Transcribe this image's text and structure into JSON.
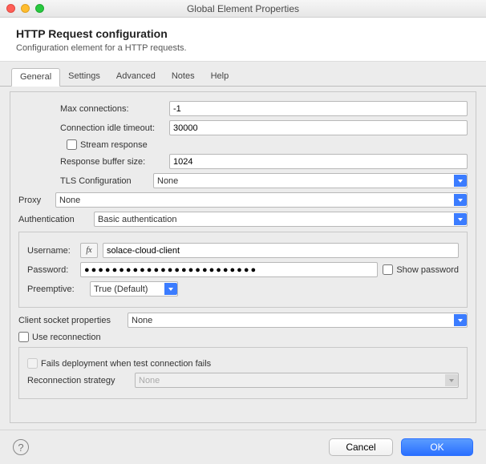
{
  "window": {
    "title": "Global Element Properties"
  },
  "header": {
    "title": "HTTP Request configuration",
    "subtitle": "Configuration element for a HTTP requests."
  },
  "tabs": {
    "t0": "General",
    "t1": "Settings",
    "t2": "Advanced",
    "t3": "Notes",
    "t4": "Help"
  },
  "fields": {
    "maxConnLabel": "Max connections:",
    "maxConn": "-1",
    "idleLabel": "Connection idle timeout:",
    "idle": "30000",
    "streamLabel": "Stream response",
    "respBufLabel": "Response buffer size:",
    "respBuf": "1024",
    "tlsLabel": "TLS Configuration",
    "tls": "None",
    "proxyLabel": "Proxy",
    "proxy": "None",
    "authLabel": "Authentication",
    "auth": "Basic authentication",
    "userLabel": "Username:",
    "user": "solace-cloud-client",
    "passLabel": "Password:",
    "pass": "●●●●●●●●●●●●●●●●●●●●●●●●●",
    "showPwLabel": "Show password",
    "preLabel": "Preemptive:",
    "pre": "True (Default)",
    "clientSockLabel": "Client socket properties",
    "clientSock": "None",
    "useReconLabel": "Use reconnection",
    "failDeployLabel": "Fails deployment when test connection fails",
    "reconStratLabel": "Reconnection strategy",
    "reconStrat": "None",
    "fxLabel": "fx"
  },
  "footer": {
    "help": "?",
    "cancel": "Cancel",
    "ok": "OK"
  }
}
